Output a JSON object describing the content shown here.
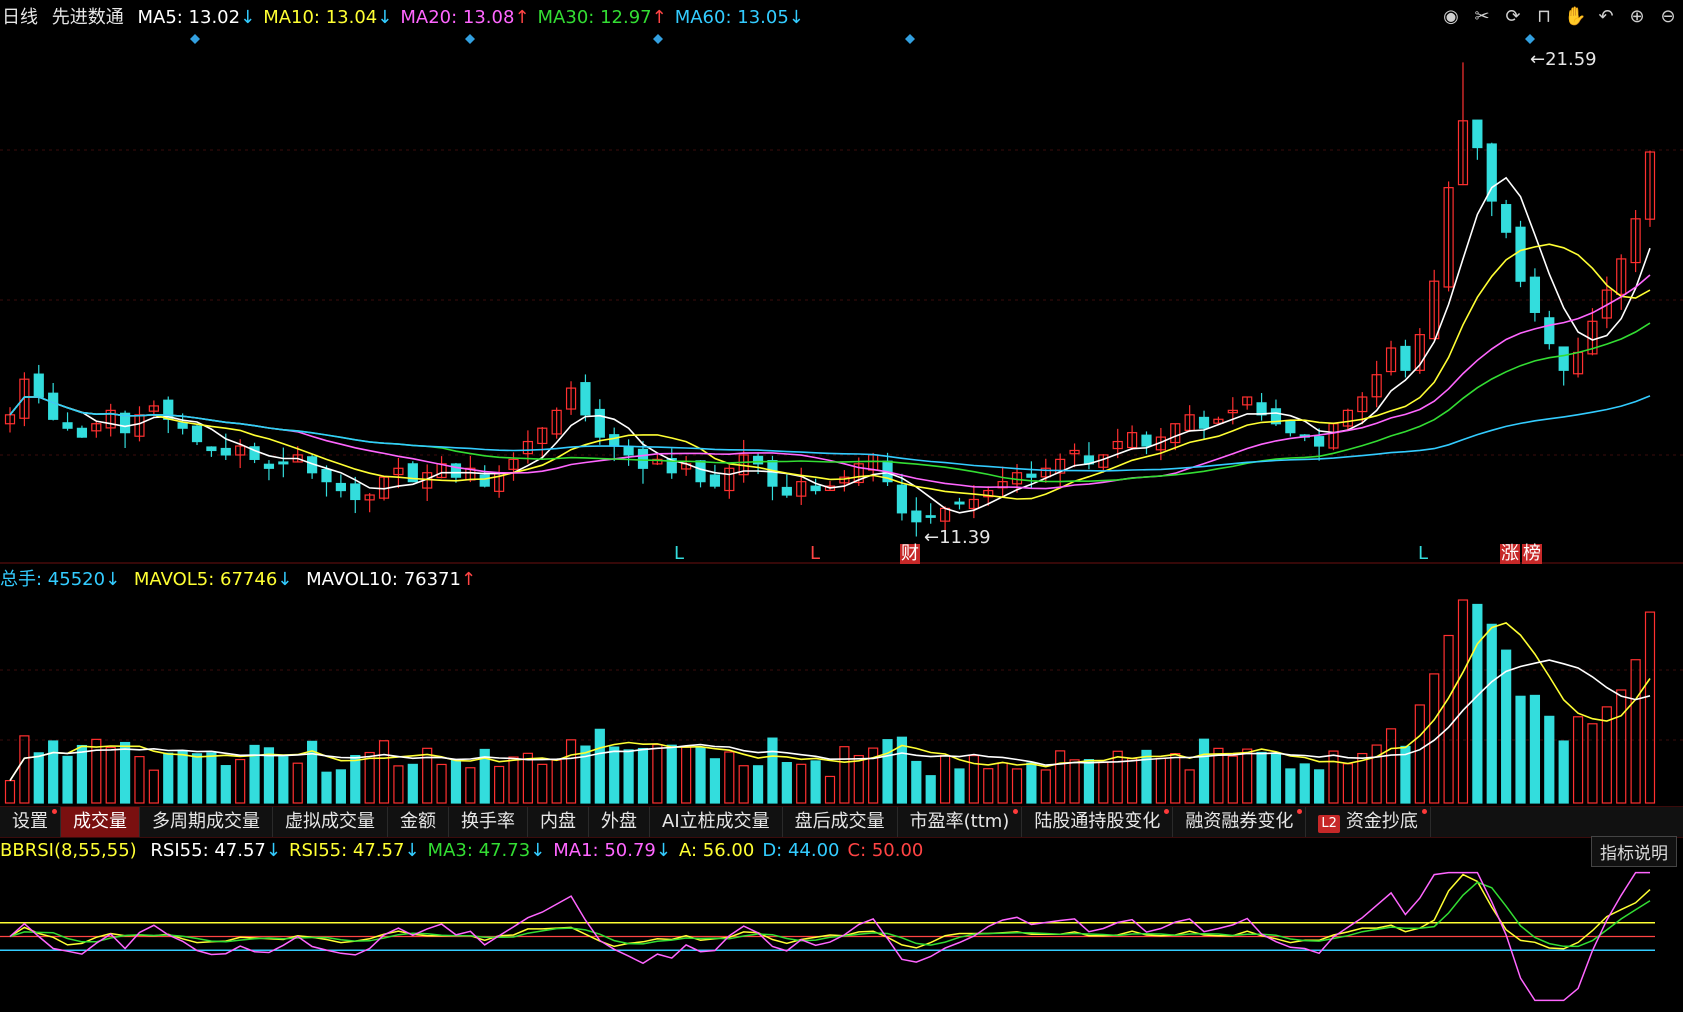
{
  "header": {
    "period": "日线",
    "stock_name": "先进数通",
    "ma": [
      {
        "label": "MA5: ",
        "value": "13.02",
        "arrow": "↓",
        "color": "#ffffff"
      },
      {
        "label": "MA10: ",
        "value": "13.04",
        "arrow": "↓",
        "color": "#ffff33"
      },
      {
        "label": "MA20: ",
        "value": "13.08",
        "arrow": "↑",
        "color": "#ff66ff"
      },
      {
        "label": "MA30: ",
        "value": "12.97",
        "arrow": "↑",
        "color": "#33dd33"
      },
      {
        "label": "MA60: ",
        "value": "13.05",
        "arrow": "↓",
        "color": "#33ccff"
      }
    ]
  },
  "toolbar_icons": [
    "eye-icon",
    "scissors-icon",
    "replay-icon",
    "lock-icon",
    "hand-icon",
    "undo-icon",
    "zoom-in-icon",
    "zoom-out-icon"
  ],
  "price_panel": {
    "high_label": "21.59",
    "low_label": "11.39",
    "markers": [
      "L",
      "L",
      "财",
      "L",
      "涨",
      "榜"
    ]
  },
  "volume_panel": {
    "total_label": "总手: ",
    "total_value": "45520",
    "total_arrow": "↓",
    "mavol5_label": "MAVOL5: ",
    "mavol5_value": "67746",
    "mavol5_arrow": "↓",
    "mavol10_label": "MAVOL10: ",
    "mavol10_value": "76371",
    "mavol10_arrow": "↑"
  },
  "tabs": [
    {
      "label": "设置",
      "dot": true,
      "active": false
    },
    {
      "label": "成交量",
      "dot": false,
      "active": true
    },
    {
      "label": "多周期成交量",
      "dot": false,
      "active": false
    },
    {
      "label": "虚拟成交量",
      "dot": false,
      "active": false
    },
    {
      "label": "金额",
      "dot": false,
      "active": false
    },
    {
      "label": "换手率",
      "dot": false,
      "active": false
    },
    {
      "label": "内盘",
      "dot": false,
      "active": false
    },
    {
      "label": "外盘",
      "dot": false,
      "active": false
    },
    {
      "label": "AI立桩成交量",
      "dot": false,
      "active": false
    },
    {
      "label": "盘后成交量",
      "dot": false,
      "active": false
    },
    {
      "label": "市盈率(ttm)",
      "dot": true,
      "active": false
    },
    {
      "label": "陆股通持股变化",
      "dot": true,
      "active": false
    },
    {
      "label": "融资融券变化",
      "dot": true,
      "active": false
    },
    {
      "label": "资金抄底",
      "dot": true,
      "active": false,
      "badge": "L2"
    }
  ],
  "indicator": {
    "name": "BBRSI(8,55,55)",
    "items": [
      {
        "label": "RSI55: ",
        "value": "47.57",
        "arrow": "↓",
        "color": "#ffffff"
      },
      {
        "label": "RSI55: ",
        "value": "47.57",
        "arrow": "↓",
        "color": "#ffff33"
      },
      {
        "label": "MA3: ",
        "value": "47.73",
        "arrow": "↓",
        "color": "#33dd33"
      },
      {
        "label": "MA1: ",
        "value": "50.79",
        "arrow": "↓",
        "color": "#ff66ff"
      },
      {
        "label": "A: ",
        "value": "56.00",
        "arrow": "",
        "color": "#ffff33"
      },
      {
        "label": "D: ",
        "value": "44.00",
        "arrow": "",
        "color": "#33ccff"
      },
      {
        "label": "C: ",
        "value": "50.00",
        "arrow": "",
        "color": "#ff4444"
      }
    ],
    "explain_button": "指标说明"
  },
  "colors": {
    "up": "#ff3030",
    "down": "#33dddd",
    "ma5": "#ffffff",
    "ma10": "#ffff33",
    "ma20": "#ff66ff",
    "ma30": "#33dd33",
    "ma60": "#33ccff"
  },
  "chart_data": {
    "type": "candlestick",
    "closes": [
      13.8,
      14.6,
      14.2,
      13.7,
      13.5,
      13.3,
      13.6,
      13.9,
      13.4,
      13.8,
      14.0,
      13.7,
      13.5,
      13.2,
      13.0,
      12.9,
      13.1,
      12.8,
      12.6,
      12.7,
      12.9,
      12.5,
      12.3,
      12.1,
      11.9,
      12.0,
      12.4,
      12.6,
      12.3,
      12.5,
      12.7,
      12.4,
      12.6,
      12.2,
      12.5,
      12.8,
      13.2,
      13.5,
      13.9,
      14.4,
      13.8,
      13.3,
      13.1,
      12.9,
      12.6,
      12.8,
      12.5,
      12.7,
      12.3,
      12.2,
      12.6,
      12.9,
      12.7,
      12.2,
      12.0,
      12.3,
      12.1,
      12.2,
      12.4,
      12.7,
      12.9,
      12.3,
      11.6,
      11.4,
      11.5,
      11.7,
      11.8,
      11.9,
      12.1,
      12.3,
      12.5,
      12.4,
      12.6,
      12.8,
      13.0,
      12.7,
      12.9,
      13.2,
      13.4,
      13.1,
      13.3,
      13.6,
      13.8,
      13.5,
      13.7,
      13.9,
      14.2,
      13.8,
      13.6,
      13.4,
      13.3,
      13.1,
      13.6,
      13.9,
      14.2,
      14.7,
      15.3,
      14.8,
      15.6,
      16.8,
      18.9,
      20.4,
      19.8,
      18.6,
      17.9,
      16.8,
      16.1,
      15.4,
      14.8,
      15.2,
      15.9,
      16.6,
      17.3,
      18.2,
      19.7
    ],
    "volume_axis_note": "",
    "high": 21.59,
    "low": 11.39
  }
}
